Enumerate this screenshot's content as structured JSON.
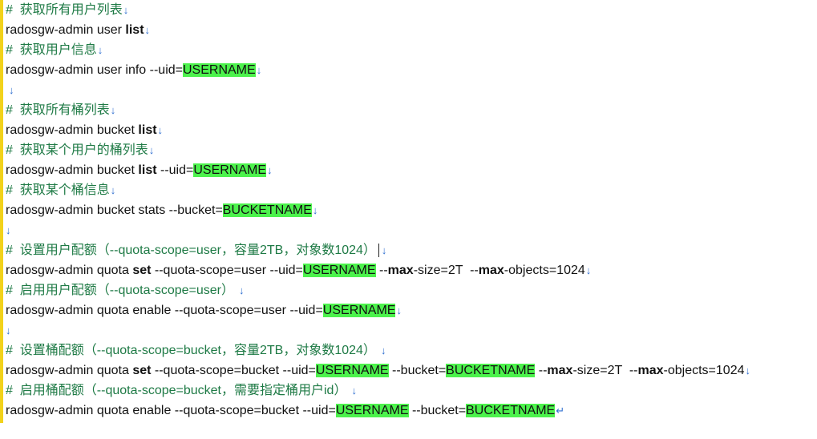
{
  "marks": {
    "paragraph": "↓",
    "end": "↵"
  },
  "lines": [
    {
      "type": "comment",
      "text": "#  获取所有用户列表"
    },
    {
      "type": "code",
      "text": "radosgw-admin user ",
      "bold": "list"
    },
    {
      "type": "comment",
      "text": "#  获取用户信息"
    },
    {
      "type": "code",
      "text": "radosgw-admin user info --uid=",
      "hl": "USERNAME"
    },
    {
      "type": "empty"
    },
    {
      "type": "comment",
      "text": "#  获取所有桶列表"
    },
    {
      "type": "code",
      "text": "radosgw-admin bucket ",
      "bold": "list"
    },
    {
      "type": "comment",
      "text": "#  获取某个用户的桶列表"
    },
    {
      "type": "code",
      "text": "radosgw-admin bucket ",
      "bold": "list",
      "text2": " --uid=",
      "hl": "USERNAME"
    },
    {
      "type": "comment",
      "text": "#  获取某个桶信息"
    },
    {
      "type": "code",
      "text": "radosgw-admin bucket stats --bucket=",
      "hl": "BUCKETNAME"
    },
    {
      "type": "empty"
    },
    {
      "type": "comment",
      "text": "#  设置用户配额（--quota-scope=user，容量2TB，对象数1024）"
    },
    {
      "type": "set-user",
      "a": "radosgw-admin quota ",
      "b": "set",
      "c": " --quota-scope=user --uid=",
      "hl": "USERNAME",
      "d": " --",
      "e": "max",
      "f": "-size=2T  --",
      "g": "max",
      "h": "-objects=1024"
    },
    {
      "type": "comment",
      "text": "#  启用用户配额（--quota-scope=user）"
    },
    {
      "type": "code",
      "text": "radosgw-admin quota enable --quota-scope=user --uid=",
      "hl": "USERNAME"
    },
    {
      "type": "empty"
    },
    {
      "type": "comment",
      "text": "#  设置桶配额（--quota-scope=bucket，容量2TB，对象数1024）"
    },
    {
      "type": "set-bucket",
      "a": "radosgw-admin quota ",
      "b": "set",
      "c": " --quota-scope=bucket --uid=",
      "hl": "USERNAME",
      "d": " --bucket=",
      "hl2": "BUCKETNAME",
      "e": " --",
      "f": "max",
      "g": "-size=2T  --",
      "h": "max",
      "i": "-objects=1024"
    },
    {
      "type": "comment",
      "text": "#  启用桶配额（--quota-scope=bucket，需要指定桶用户id）"
    },
    {
      "type": "enable-bucket",
      "a": "radosgw-admin quota enable --quota-scope=bucket --uid=",
      "hl": "USERNAME",
      "b": " --bucket=",
      "hl2": "BUCKETNAME"
    }
  ]
}
